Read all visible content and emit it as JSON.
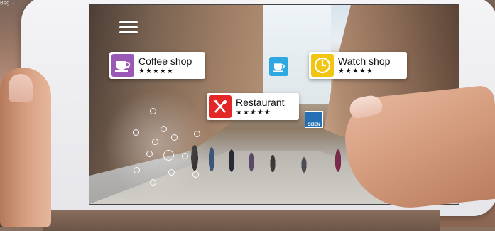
{
  "watermark": "Beg...",
  "pois": [
    {
      "name": "Coffee shop",
      "rating": "★★★★★",
      "icon": "coffee-cup-icon",
      "color": "#9b59b6"
    },
    {
      "name": "Watch shop",
      "rating": "★★★★★",
      "icon": "clock-icon",
      "color": "#f2c511"
    },
    {
      "name": "Restaurant",
      "rating": "★★★★★",
      "icon": "fork-knife-icon",
      "color": "#e32727"
    }
  ],
  "mini_poi": {
    "icon": "coffee-cup-icon",
    "color": "#2ea8e0"
  },
  "street_sign": {
    "text": "SIJEN"
  },
  "controls": {
    "menu_icon": "hamburger-menu-icon",
    "camera_icon": "camera-icon"
  }
}
